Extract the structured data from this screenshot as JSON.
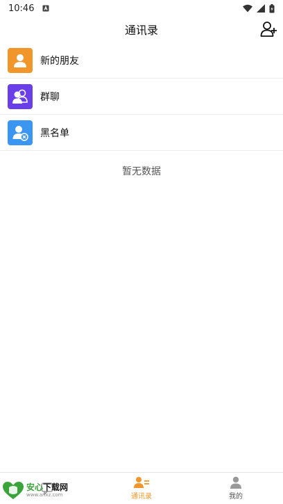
{
  "status_bar": {
    "time": "10:46"
  },
  "header": {
    "title": "通讯录"
  },
  "contacts": {
    "items": [
      {
        "label": "新的朋友",
        "color": "#F0962A",
        "icon": "person-icon"
      },
      {
        "label": "群聊",
        "color": "#6A3EE8",
        "icon": "group-icon"
      },
      {
        "label": "黑名单",
        "color": "#3A96F0",
        "icon": "person-blocked-icon"
      }
    ],
    "empty_text": "暂无数据"
  },
  "bottom_nav": {
    "items": [
      {
        "label": "",
        "icon": "chat-icon",
        "active": false
      },
      {
        "label": "通讯录",
        "icon": "contacts-icon",
        "active": true
      },
      {
        "label": "我的",
        "icon": "profile-icon",
        "active": false
      }
    ],
    "active_color": "#F0962A",
    "inactive_color": "#999999"
  },
  "watermark": {
    "brand_green": "安心",
    "brand_dark": "下载网",
    "url": "www.anxz.com"
  }
}
